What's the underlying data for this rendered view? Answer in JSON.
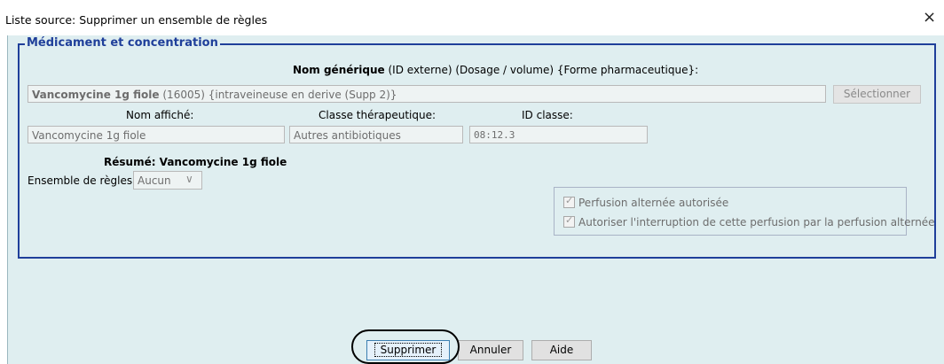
{
  "window": {
    "title": "Liste source:  Supprimer un ensemble de règles",
    "close": "×"
  },
  "group": {
    "legend": "Médicament et concentration",
    "header_bold": "Nom générique",
    "header_rest": " (ID externe) (Dosage / volume) {Forme pharmaceutique}:",
    "drug_bold": "Vancomycine 1g fiole",
    "drug_rest": " (16005) {intraveineuse en derive (Supp 2)}",
    "select_button": "Sélectionner",
    "labels": {
      "display_name": "Nom affiché:",
      "therapeutic_class": "Classe thérapeutique:",
      "class_id": "ID classe:"
    },
    "values": {
      "display_name": "Vancomycine 1g fiole",
      "therapeutic_class": "Autres antibiotiques",
      "class_id": "08:12.3"
    },
    "summary": "Résumé: Vancomycine 1g fiole",
    "ruleset_label": "Ensemble de règles:",
    "ruleset_value": "Aucun",
    "checkboxes": [
      {
        "label": "Perfusion alternée autorisée",
        "checked": true
      },
      {
        "label": "Autoriser l'interruption de cette perfusion par la perfusion alternée",
        "checked": true
      }
    ]
  },
  "buttons": {
    "delete": "Supprimer",
    "cancel": "Annuler",
    "help": "Aide"
  },
  "colors": {
    "background": "#dfeef0",
    "group_border": "#1f3f9a",
    "field_bg": "#eef3f3"
  }
}
